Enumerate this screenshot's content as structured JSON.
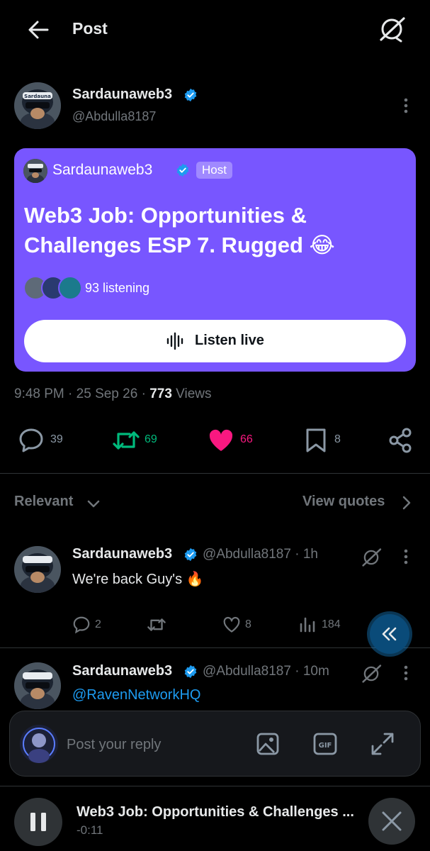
{
  "header": {
    "title": "Post"
  },
  "author": {
    "name": "Sardaunaweb3",
    "handle": "@Abdulla8187",
    "avatar_text": "Sardauna"
  },
  "space": {
    "host_name": "Sardaunaweb3",
    "host_badge": "Host",
    "title": "Web3 Job: Opportunities & Challenges ESP 7. Rugged 😂",
    "listeners": "93 listening",
    "listen_button": "Listen live",
    "color": "#7856ff"
  },
  "meta": {
    "time": "9:48 PM",
    "sep1": "·",
    "date": "25 Sep 26",
    "sep2": "·",
    "views_count": "773",
    "views_label": "Views"
  },
  "actions": {
    "replies": "39",
    "reposts": "69",
    "likes": "66",
    "bookmarks": "8"
  },
  "colors": {
    "repost": "#00ba7c",
    "like": "#f91880",
    "mention": "#1d9bf0"
  },
  "sort": {
    "label": "Relevant",
    "quotes": "View quotes"
  },
  "replies": [
    {
      "name": "Sardaunaweb3",
      "handle": "@Abdulla8187 · 1h",
      "text": "We're back Guy's 🔥",
      "replies": "2",
      "reposts": "",
      "likes": "8",
      "views": "184"
    },
    {
      "name": "Sardaunaweb3",
      "handle": "@Abdulla8187 · 10m",
      "text": "@RavenNetworkHQ"
    }
  ],
  "composer": {
    "placeholder": "Post your reply"
  },
  "player": {
    "title": "Web3 Job: Opportunities & Challenges ...",
    "time": "-0:11"
  }
}
